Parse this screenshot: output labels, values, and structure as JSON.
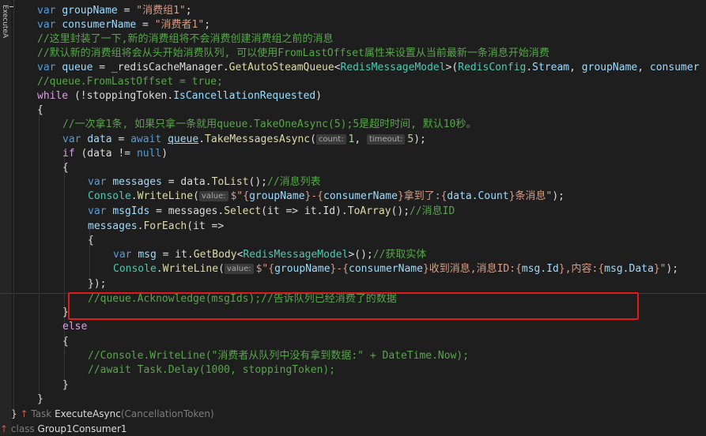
{
  "gutter_label": "ExecuteA",
  "code": {
    "l1": {
      "kw": "var",
      "name": "groupName",
      "eq": " = ",
      "val": "\"消费组1\"",
      "end": ";"
    },
    "l2": {
      "kw": "var",
      "name": "consumerName",
      "eq": " = ",
      "val": "\"消费者1\"",
      "end": ";"
    },
    "l3": "//这里封装了一下,新的消费组将不会消费创建消费组之前的消息",
    "l4": "//默认新的消费组将会从头开始消费队列, 可以使用FromLastOffset属性来设置从当前最新一条消息开始消费",
    "l5": {
      "kw": "var",
      "name": "queue",
      "p1": " = _redisCacheManager.",
      "method": "GetAutoSteamQueue",
      "p2": "<",
      "type": "RedisMessageModel",
      "p3": ">(",
      "type2": "RedisConfig",
      "p4": ".",
      "name2": "Stream",
      "p5": ", ",
      "name3": "groupName",
      "p6": ", ",
      "name4": "consumer"
    },
    "l6": "//queue.FromLastOffset = true;",
    "l7": {
      "kw": "while",
      "p1": " (!stoppingToken.",
      "name": "IsCancellationRequested",
      "p2": ")"
    },
    "l8": "{",
    "l9": "//一次拿1条, 如果只拿一条就用queue.TakeOneAsync(5);5是超时时间, 默认10秒。",
    "l10": {
      "kw": "var",
      "name": "data",
      "p1": " = ",
      "kw2": "await",
      "p2": " ",
      "name2": "queue",
      "p3": ".",
      "method": "TakeMessagesAsync",
      "p4": "(",
      "hint1": "count:",
      "num1": "1",
      "p5": ", ",
      "hint2": "timeout:",
      "num2": "5",
      "p6": ");"
    },
    "l11": {
      "kw": "if",
      "p1": " (data != ",
      "kw2": "null",
      "p2": ")"
    },
    "l12": "{",
    "l13": {
      "kw": "var",
      "name": "messages",
      "p1": " = data.",
      "method": "ToList",
      "p2": "();",
      "cm": "//消息列表"
    },
    "l14": {
      "type": "Console",
      "p1": ".",
      "method": "WriteLine",
      "p2": "(",
      "hint": "value:",
      "str1": "$\"{",
      "name1": "groupName",
      "str2": "}-{",
      "name2": "consumerName",
      "str3": "}拿到了:{",
      "name3": "data.Count",
      "str4": "}条消息\"",
      "p3": ");"
    },
    "l15": {
      "kw": "var",
      "name": "msgIds",
      "p1": " = messages.",
      "method": "Select",
      "p2": "(it => it.Id).",
      "method2": "ToArray",
      "p3": "();",
      "cm": "//消息ID"
    },
    "l16": {
      "name": "messages",
      "p1": ".",
      "method": "ForEach",
      "p2": "(it =>"
    },
    "l17": "{",
    "l18": {
      "kw": "var",
      "name": "msg",
      "p1": " = it.",
      "method": "GetBody",
      "p2": "<",
      "type": "RedisMessageModel",
      "p3": ">();",
      "cm": "//获取实体"
    },
    "l19": {
      "type": "Console",
      "p1": ".",
      "method": "WriteLine",
      "p2": "(",
      "hint": "value:",
      "str1": "$\"{",
      "name1": "groupName",
      "str2": "}-{",
      "name2": "consumerName",
      "str3": "}收到消息,消息ID:{",
      "name3": "msg.Id",
      "str4": "},内容:{",
      "name4": "msg.Data",
      "str5": "}\"",
      "p3": ");"
    },
    "l20": "});",
    "l21": "//queue.Acknowledge(msgIds);//告诉队列已经消费了的数据",
    "l22": "}",
    "l23": "else",
    "l24": "{",
    "l25": "//Console.WriteLine(\"消费者从队列中没有拿到数据:\" + DateTime.Now);",
    "l26": "//await Task.Delay(1000, stoppingToken);",
    "l27": "}",
    "l28": "}",
    "l29": "}"
  },
  "footer": {
    "brace": "}",
    "arrow1": "↑",
    "task_kw": "Task",
    "method": "ExecuteAsync",
    "param": "(CancellationToken)",
    "arrow2": "↑",
    "class_kw": "class",
    "class_name": "Group1Consumer1"
  },
  "colors": {
    "annotation_box": "#e01b1b",
    "background": "#1e1e1e"
  }
}
